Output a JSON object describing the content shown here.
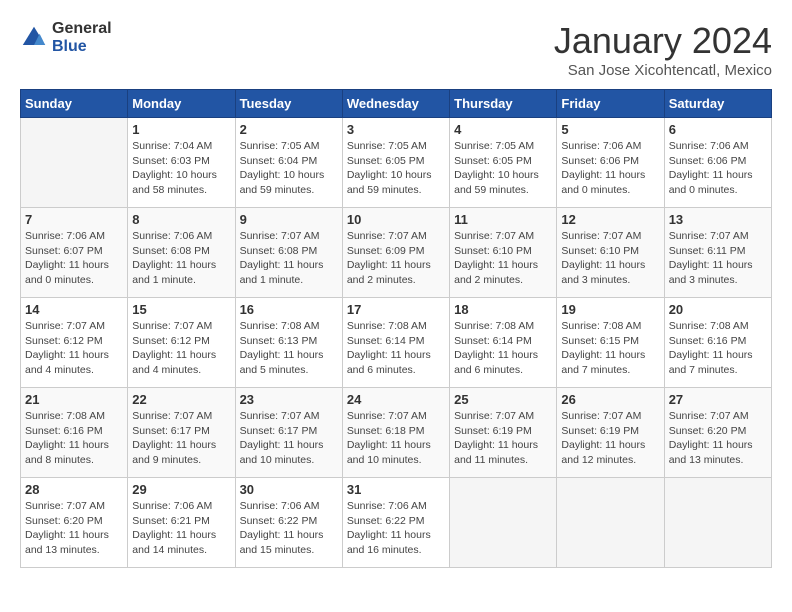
{
  "header": {
    "logo_general": "General",
    "logo_blue": "Blue",
    "title": "January 2024",
    "subtitle": "San Jose Xicohtencatl, Mexico"
  },
  "days_of_week": [
    "Sunday",
    "Monday",
    "Tuesday",
    "Wednesday",
    "Thursday",
    "Friday",
    "Saturday"
  ],
  "weeks": [
    [
      {
        "day": "",
        "info": ""
      },
      {
        "day": "1",
        "info": "Sunrise: 7:04 AM\nSunset: 6:03 PM\nDaylight: 10 hours\nand 58 minutes."
      },
      {
        "day": "2",
        "info": "Sunrise: 7:05 AM\nSunset: 6:04 PM\nDaylight: 10 hours\nand 59 minutes."
      },
      {
        "day": "3",
        "info": "Sunrise: 7:05 AM\nSunset: 6:05 PM\nDaylight: 10 hours\nand 59 minutes."
      },
      {
        "day": "4",
        "info": "Sunrise: 7:05 AM\nSunset: 6:05 PM\nDaylight: 10 hours\nand 59 minutes."
      },
      {
        "day": "5",
        "info": "Sunrise: 7:06 AM\nSunset: 6:06 PM\nDaylight: 11 hours\nand 0 minutes."
      },
      {
        "day": "6",
        "info": "Sunrise: 7:06 AM\nSunset: 6:06 PM\nDaylight: 11 hours\nand 0 minutes."
      }
    ],
    [
      {
        "day": "7",
        "info": "Sunrise: 7:06 AM\nSunset: 6:07 PM\nDaylight: 11 hours\nand 0 minutes."
      },
      {
        "day": "8",
        "info": "Sunrise: 7:06 AM\nSunset: 6:08 PM\nDaylight: 11 hours\nand 1 minute."
      },
      {
        "day": "9",
        "info": "Sunrise: 7:07 AM\nSunset: 6:08 PM\nDaylight: 11 hours\nand 1 minute."
      },
      {
        "day": "10",
        "info": "Sunrise: 7:07 AM\nSunset: 6:09 PM\nDaylight: 11 hours\nand 2 minutes."
      },
      {
        "day": "11",
        "info": "Sunrise: 7:07 AM\nSunset: 6:10 PM\nDaylight: 11 hours\nand 2 minutes."
      },
      {
        "day": "12",
        "info": "Sunrise: 7:07 AM\nSunset: 6:10 PM\nDaylight: 11 hours\nand 3 minutes."
      },
      {
        "day": "13",
        "info": "Sunrise: 7:07 AM\nSunset: 6:11 PM\nDaylight: 11 hours\nand 3 minutes."
      }
    ],
    [
      {
        "day": "14",
        "info": "Sunrise: 7:07 AM\nSunset: 6:12 PM\nDaylight: 11 hours\nand 4 minutes."
      },
      {
        "day": "15",
        "info": "Sunrise: 7:07 AM\nSunset: 6:12 PM\nDaylight: 11 hours\nand 4 minutes."
      },
      {
        "day": "16",
        "info": "Sunrise: 7:08 AM\nSunset: 6:13 PM\nDaylight: 11 hours\nand 5 minutes."
      },
      {
        "day": "17",
        "info": "Sunrise: 7:08 AM\nSunset: 6:14 PM\nDaylight: 11 hours\nand 6 minutes."
      },
      {
        "day": "18",
        "info": "Sunrise: 7:08 AM\nSunset: 6:14 PM\nDaylight: 11 hours\nand 6 minutes."
      },
      {
        "day": "19",
        "info": "Sunrise: 7:08 AM\nSunset: 6:15 PM\nDaylight: 11 hours\nand 7 minutes."
      },
      {
        "day": "20",
        "info": "Sunrise: 7:08 AM\nSunset: 6:16 PM\nDaylight: 11 hours\nand 7 minutes."
      }
    ],
    [
      {
        "day": "21",
        "info": "Sunrise: 7:08 AM\nSunset: 6:16 PM\nDaylight: 11 hours\nand 8 minutes."
      },
      {
        "day": "22",
        "info": "Sunrise: 7:07 AM\nSunset: 6:17 PM\nDaylight: 11 hours\nand 9 minutes."
      },
      {
        "day": "23",
        "info": "Sunrise: 7:07 AM\nSunset: 6:17 PM\nDaylight: 11 hours\nand 10 minutes."
      },
      {
        "day": "24",
        "info": "Sunrise: 7:07 AM\nSunset: 6:18 PM\nDaylight: 11 hours\nand 10 minutes."
      },
      {
        "day": "25",
        "info": "Sunrise: 7:07 AM\nSunset: 6:19 PM\nDaylight: 11 hours\nand 11 minutes."
      },
      {
        "day": "26",
        "info": "Sunrise: 7:07 AM\nSunset: 6:19 PM\nDaylight: 11 hours\nand 12 minutes."
      },
      {
        "day": "27",
        "info": "Sunrise: 7:07 AM\nSunset: 6:20 PM\nDaylight: 11 hours\nand 13 minutes."
      }
    ],
    [
      {
        "day": "28",
        "info": "Sunrise: 7:07 AM\nSunset: 6:20 PM\nDaylight: 11 hours\nand 13 minutes."
      },
      {
        "day": "29",
        "info": "Sunrise: 7:06 AM\nSunset: 6:21 PM\nDaylight: 11 hours\nand 14 minutes."
      },
      {
        "day": "30",
        "info": "Sunrise: 7:06 AM\nSunset: 6:22 PM\nDaylight: 11 hours\nand 15 minutes."
      },
      {
        "day": "31",
        "info": "Sunrise: 7:06 AM\nSunset: 6:22 PM\nDaylight: 11 hours\nand 16 minutes."
      },
      {
        "day": "",
        "info": ""
      },
      {
        "day": "",
        "info": ""
      },
      {
        "day": "",
        "info": ""
      }
    ]
  ]
}
